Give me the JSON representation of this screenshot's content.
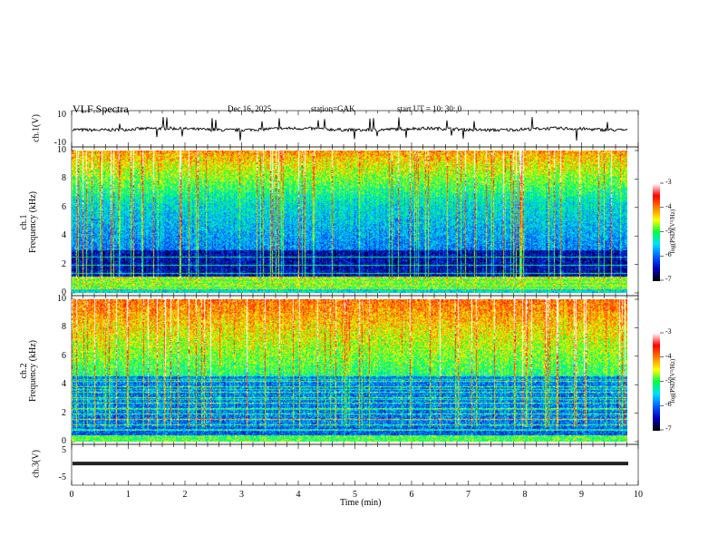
{
  "header": {
    "title": "VLF  Spectra",
    "date": "Dec.16, 2025",
    "station": "station=GAK",
    "start": "start  UT  =    10: 30: 0"
  },
  "colors": {
    "trace": "#000000",
    "background": "#ffffff"
  },
  "xaxis": {
    "label": "Time  (min)",
    "ticks": [
      "0",
      "1",
      "2",
      "3",
      "4",
      "5",
      "6",
      "7",
      "8",
      "9",
      "10"
    ],
    "range": [
      0,
      10
    ]
  },
  "colorbar": {
    "label": "log(PSD)(V²/Hz)",
    "ticks": [
      "-3",
      "-4",
      "-5",
      "-6",
      "-7"
    ],
    "range": [
      -7,
      -3
    ],
    "colormap": [
      "#000000",
      "#0000c0",
      "#0060ff",
      "#00e0ff",
      "#00ff40",
      "#ffff00",
      "#ff8000",
      "#ff0000",
      "#ffffff"
    ]
  },
  "chart_data": [
    {
      "type": "line",
      "panel": "ch1-waveform",
      "ylabel": "ch.1(V)",
      "yticks": [
        "10",
        "-10"
      ],
      "ylim": [
        -10,
        10
      ],
      "x_range": [
        0,
        9.8
      ],
      "mean_value": 0,
      "description_level": "noisy waveform around 0 V with spikes"
    },
    {
      "type": "heatmap",
      "panel": "ch1-spectrogram",
      "ylabel_top": "ch.1",
      "ylabel": "Frequency  (kHz)",
      "yticks": [
        "10",
        "8",
        "6",
        "4",
        "2",
        "0"
      ],
      "ylim": [
        0,
        10
      ],
      "xlim": [
        0,
        9.8
      ],
      "zlim": [
        -7,
        -3
      ]
    },
    {
      "type": "heatmap",
      "panel": "ch2-spectrogram",
      "ylabel_top": "ch.2",
      "ylabel": "Frequency  (kHz)",
      "yticks": [
        "10",
        "8",
        "6",
        "4",
        "2",
        "0"
      ],
      "ylim": [
        0,
        10
      ],
      "xlim": [
        0,
        9.8
      ],
      "zlim": [
        -7,
        -3
      ]
    },
    {
      "type": "line",
      "panel": "ch3-waveform",
      "ylabel": "ch.3(V)",
      "yticks": [
        "5",
        "-5"
      ],
      "ylim": [
        -5,
        5
      ],
      "x_range": [
        0,
        9.8
      ],
      "mean_value": 0.3
    }
  ]
}
